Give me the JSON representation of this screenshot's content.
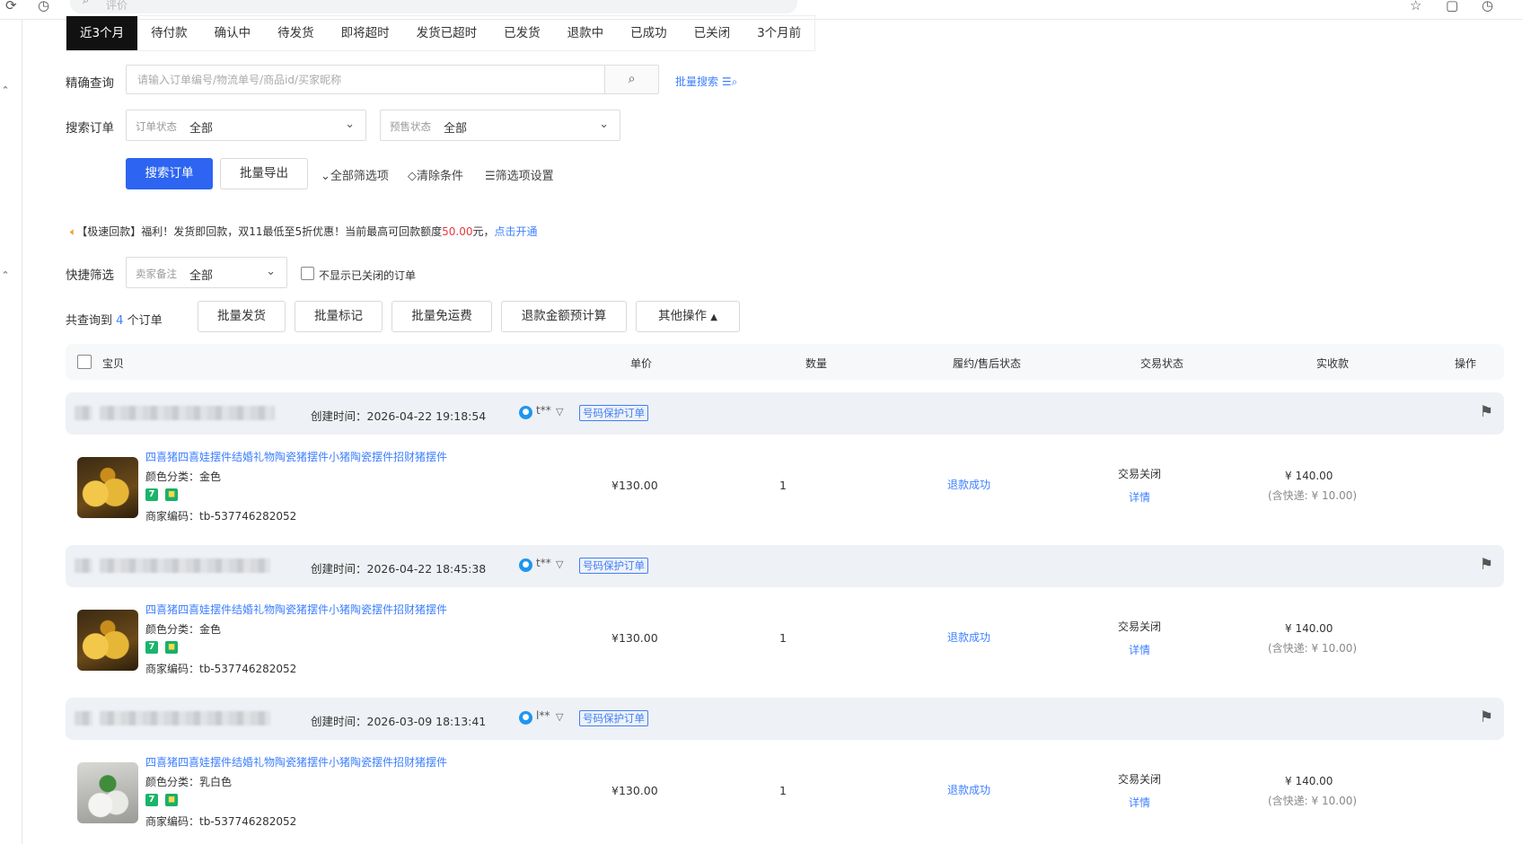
{
  "browser": {
    "search_placeholder": "评价"
  },
  "tabs": [
    "近3个月",
    "待付款",
    "确认中",
    "待发货",
    "即将超时",
    "发货已超时",
    "已发货",
    "退款中",
    "已成功",
    "已关闭",
    "3个月前"
  ],
  "search": {
    "exact_label": "精确查询",
    "placeholder": "请输入订单编号/物流单号/商品id/买家昵称",
    "batch_search": "批量搜索",
    "orders_label": "搜索订单",
    "order_status_key": "订单状态",
    "order_status_value": "全部",
    "presale_key": "预售状态",
    "presale_value": "全部",
    "search_button": "搜索订单",
    "export_button": "批量导出",
    "all_filters": "全部筛选项",
    "clear": "清除条件",
    "filter_settings": "筛选项设置"
  },
  "notice": {
    "text": "【极速回款】福利！发货即回款，双11最低至5折优惠！当前最高可回款额度",
    "amount": "50.00",
    "unit": "元，",
    "link": "点击开通"
  },
  "quick": {
    "label": "快捷筛选",
    "remark_key": "卖家备注",
    "remark_value": "全部",
    "hide_closed": "不显示已关闭的订单"
  },
  "summary": {
    "prefix": "共查询到",
    "count": "4",
    "suffix": "个订单"
  },
  "actions": [
    "批量发货",
    "批量标记",
    "批量免运费",
    "退款金额预计算",
    "其他操作"
  ],
  "table_header": {
    "item": "宝贝",
    "price": "单价",
    "qty": "数量",
    "after_sale": "履约/售后状态",
    "trade_status": "交易状态",
    "received": "实收款",
    "ops": "操作"
  },
  "orders": [
    {
      "created": "创建时间：2026-04-22 19:18:54",
      "user": "t**",
      "protect": "号码保护订单",
      "title": "四喜猪四喜娃摆件结婚礼物陶瓷猪摆件小猪陶瓷摆件招财猪摆件",
      "spec": "颜色分类：金色",
      "code": "商家编码：tb-537746282052",
      "price": "¥130.00",
      "qty": "1",
      "after_sale": "退款成功",
      "status": "交易关闭",
      "detail": "详情",
      "received": "¥ 140.00",
      "shipping": "(含快递: ¥ 10.00)"
    },
    {
      "created": "创建时间：2026-04-22 18:45:38",
      "user": "t**",
      "protect": "号码保护订单",
      "title": "四喜猪四喜娃摆件结婚礼物陶瓷猪摆件小猪陶瓷摆件招财猪摆件",
      "spec": "颜色分类：金色",
      "code": "商家编码：tb-537746282052",
      "price": "¥130.00",
      "qty": "1",
      "after_sale": "退款成功",
      "status": "交易关闭",
      "detail": "详情",
      "received": "¥ 140.00",
      "shipping": "(含快递: ¥ 10.00)"
    },
    {
      "created": "创建时间：2026-03-09 18:13:41",
      "user": "l**",
      "protect": "号码保护订单",
      "title": "四喜猪四喜娃摆件结婚礼物陶瓷猪摆件小猪陶瓷摆件招财猪摆件",
      "spec": "颜色分类：乳白色",
      "code": "商家编码：tb-537746282052",
      "price": "¥130.00",
      "qty": "1",
      "after_sale": "退款成功",
      "status": "交易关闭",
      "detail": "详情",
      "received": "¥ 140.00",
      "shipping": "(含快递: ¥ 10.00)"
    }
  ],
  "colors": {
    "accent": "#2d65f2",
    "link": "#3d7fff",
    "highlight": "#e4393c"
  }
}
